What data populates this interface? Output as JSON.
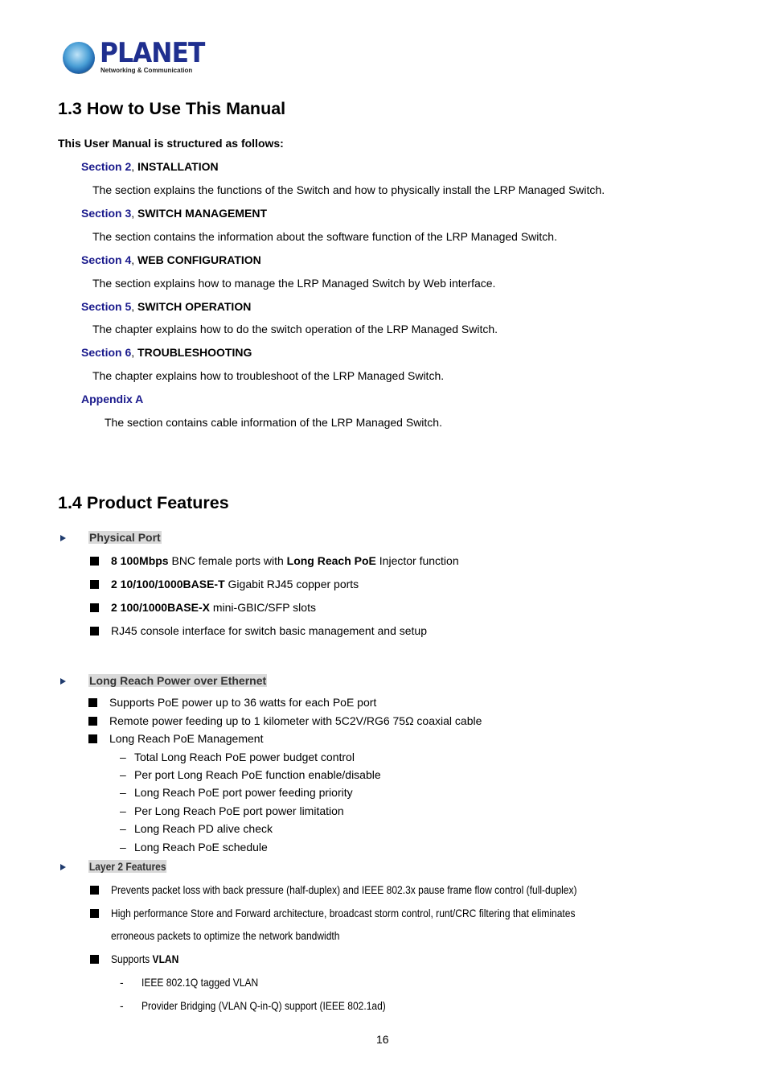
{
  "logo": {
    "brand": "PLANET",
    "tagline": "Networking & Communication"
  },
  "section_1_3": {
    "heading": "1.3 How to Use This Manual",
    "intro": "This User Manual is structured as follows:",
    "entries": [
      {
        "link": "Section 2",
        "sep": ", ",
        "title": "INSTALLATION",
        "desc": "The section explains the functions of the Switch and how to physically install the LRP Managed Switch."
      },
      {
        "link": "Section 3",
        "sep": ", ",
        "title": "SWITCH MANAGEMENT",
        "desc": "The section contains the information about the software function of the LRP Managed Switch."
      },
      {
        "link": "Section 4",
        "sep": ", ",
        "title": "WEB CONFIGURATION",
        "desc": "The section explains how to manage the LRP Managed Switch by Web interface."
      },
      {
        "link": "Section 5",
        "sep": ", ",
        "title": "SWITCH OPERATION",
        "desc": "The chapter explains how to do the switch operation of the LRP Managed Switch."
      },
      {
        "link": "Section 6",
        "sep": ", ",
        "title": "TROUBLESHOOTING",
        "desc": "The chapter explains how to troubleshoot of the LRP Managed Switch."
      },
      {
        "link": "Appendix A",
        "sep": "",
        "title": "",
        "desc": "The section contains cable information of the LRP Managed Switch."
      }
    ]
  },
  "section_1_4": {
    "heading": "1.4 Product Features",
    "groups": [
      {
        "title": "Physical Port",
        "items": [
          {
            "bold1": "8 100Mbps",
            "text1": " BNC female ports with ",
            "bold2": "Long Reach PoE",
            "text2": " Injector function"
          },
          {
            "bold1": "2 10/100/1000BASE-T",
            "text1": " Gigabit RJ45 copper ports"
          },
          {
            "bold1": "2 100/1000BASE-X",
            "text1": " mini-GBIC/SFP slots"
          },
          {
            "text1": "RJ45 console interface for switch basic management and setup"
          }
        ]
      },
      {
        "title": "Long Reach Power over Ethernet",
        "items": [
          {
            "text1": "Supports PoE power up to 36 watts for each PoE port"
          },
          {
            "text1": "Remote power feeding up to 1 kilometer with 5C2V/RG6 75Ω coaxial cable"
          },
          {
            "text1": "Long Reach PoE Management"
          }
        ],
        "subitems": [
          "Total Long Reach PoE power budget control",
          "Per port Long Reach PoE function enable/disable",
          "Long Reach PoE port power feeding priority",
          "Per Long Reach PoE port power limitation",
          "Long Reach PD alive check",
          "Long Reach PoE schedule"
        ]
      },
      {
        "title": "Layer 2 Features",
        "items": [
          {
            "text1": "Prevents packet loss with back pressure (half-duplex) and IEEE 802.3x pause frame flow control (full-duplex)"
          },
          {
            "text1": "High performance Store and Forward architecture, broadcast storm control, runt/CRC filtering that eliminates",
            "cont": "erroneous packets to optimize the network bandwidth"
          },
          {
            "text1": "Supports ",
            "bold2": "VLAN"
          }
        ],
        "subitems": [
          "IEEE 802.1Q tagged VLAN",
          "Provider Bridging (VLAN Q-in-Q) support (IEEE 802.1ad)"
        ]
      }
    ]
  },
  "page_number": "16"
}
